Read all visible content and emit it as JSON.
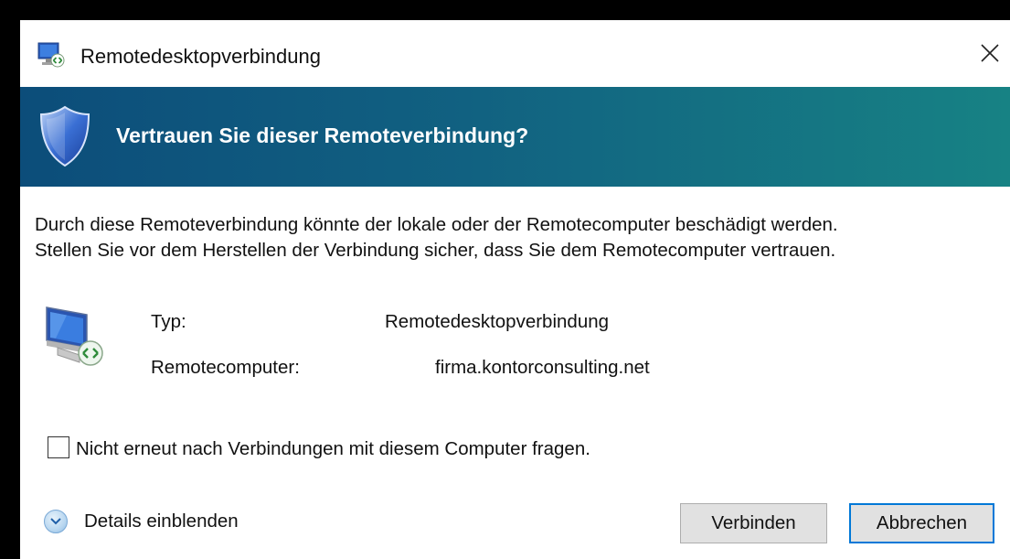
{
  "window": {
    "title": "Remotedesktopverbindung",
    "close_label": "X"
  },
  "banner": {
    "title": "Vertrauen Sie dieser Remoteverbindung?",
    "icon": "shield-icon"
  },
  "message": {
    "line1": "Durch diese Remoteverbindung könnte der lokale oder der Remotecomputer beschädigt werden.",
    "line2": "Stellen Sie vor dem Herstellen der Verbindung sicher, dass Sie dem Remotecomputer vertrauen."
  },
  "info": {
    "type_label": "Typ:",
    "type_value": "Remotedesktopverbindung",
    "computer_label": "Remotecomputer:",
    "computer_value": "firma.kontorconsulting.net",
    "icon": "monitor-connection-icon"
  },
  "checkbox": {
    "label": "Nicht erneut nach Verbindungen mit diesem Computer fragen.",
    "checked": false
  },
  "details": {
    "label": "Details einblenden",
    "icon": "chevron-down-circle-icon"
  },
  "buttons": {
    "connect": "Verbinden",
    "cancel": "Abbrechen"
  },
  "colors": {
    "banner_start": "#0c4d7a",
    "banner_end": "#178284",
    "focus_border": "#0078d7"
  }
}
